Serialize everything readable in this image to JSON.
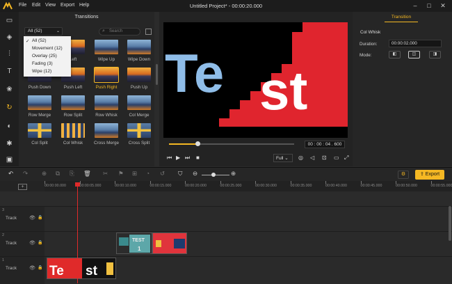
{
  "app": {
    "title": "Untitled Project* - 00:00:20.000",
    "menus": [
      "File",
      "Edit",
      "View",
      "Export",
      "Help"
    ]
  },
  "transitions": {
    "panel_title": "Transitions",
    "filter_value": "All (52)",
    "search_placeholder": "Search",
    "dropdown_options": [
      "All (52)",
      "Movement (12)",
      "Overlay (25)",
      "Fading (3)",
      "Wipe (12)"
    ],
    "items": [
      {
        "label": "",
        "style": "sunset"
      },
      {
        "label": "Left",
        "style": "sunset"
      },
      {
        "label": "Wipe Up",
        "style": "mountain"
      },
      {
        "label": "Wipe Down",
        "style": "mountain"
      },
      {
        "label": "Push Down",
        "style": "sunset"
      },
      {
        "label": "Push Left",
        "style": "sunset"
      },
      {
        "label": "Push Right",
        "style": "sunset",
        "selected": true
      },
      {
        "label": "Push Up",
        "style": "sunset"
      },
      {
        "label": "Row Merge",
        "style": "mountain"
      },
      {
        "label": "Row Split",
        "style": "mountain"
      },
      {
        "label": "Row Whisk",
        "style": "mountain"
      },
      {
        "label": "Col Merge",
        "style": "mountain"
      },
      {
        "label": "Col Split",
        "style": "cross"
      },
      {
        "label": "Col Whisk",
        "style": "cols"
      },
      {
        "label": "Cross Merge",
        "style": "mountain"
      },
      {
        "label": "Cross Split",
        "style": "cross"
      }
    ]
  },
  "preview": {
    "screen_text_1": "Te",
    "screen_text_2": "st",
    "timecode": "00 : 00 : 04 . 600",
    "progress": 0.23,
    "fullscreen_option": "Full"
  },
  "properties": {
    "tab": "Transition",
    "name": "Col Whisk",
    "duration_label": "Duration:",
    "duration_value": "00:00:02.000",
    "mode_label": "Mode:"
  },
  "timeline": {
    "export_label": "Export",
    "ruler_ticks": [
      "00:00:00.000",
      "00:00:05.000",
      "00:00:10.000",
      "00:00:15.000",
      "00:00:20.000",
      "00:00:25.000",
      "00:00:30.000",
      "00:00:35.000",
      "00:00:40.000",
      "00:00:45.000",
      "00:00:50.000",
      "00:00:55.000"
    ],
    "tracks": [
      {
        "num": "3",
        "name": "Track"
      },
      {
        "num": "2",
        "name": "Track"
      },
      {
        "num": "1",
        "name": "Track"
      }
    ],
    "clip_text_test": "TEST",
    "clip_text_1": "1"
  },
  "colors": {
    "accent": "#f5b823",
    "playhead": "#e02a2a",
    "clip_red": "#e0343c",
    "clip_teal": "#3a8a8c"
  }
}
